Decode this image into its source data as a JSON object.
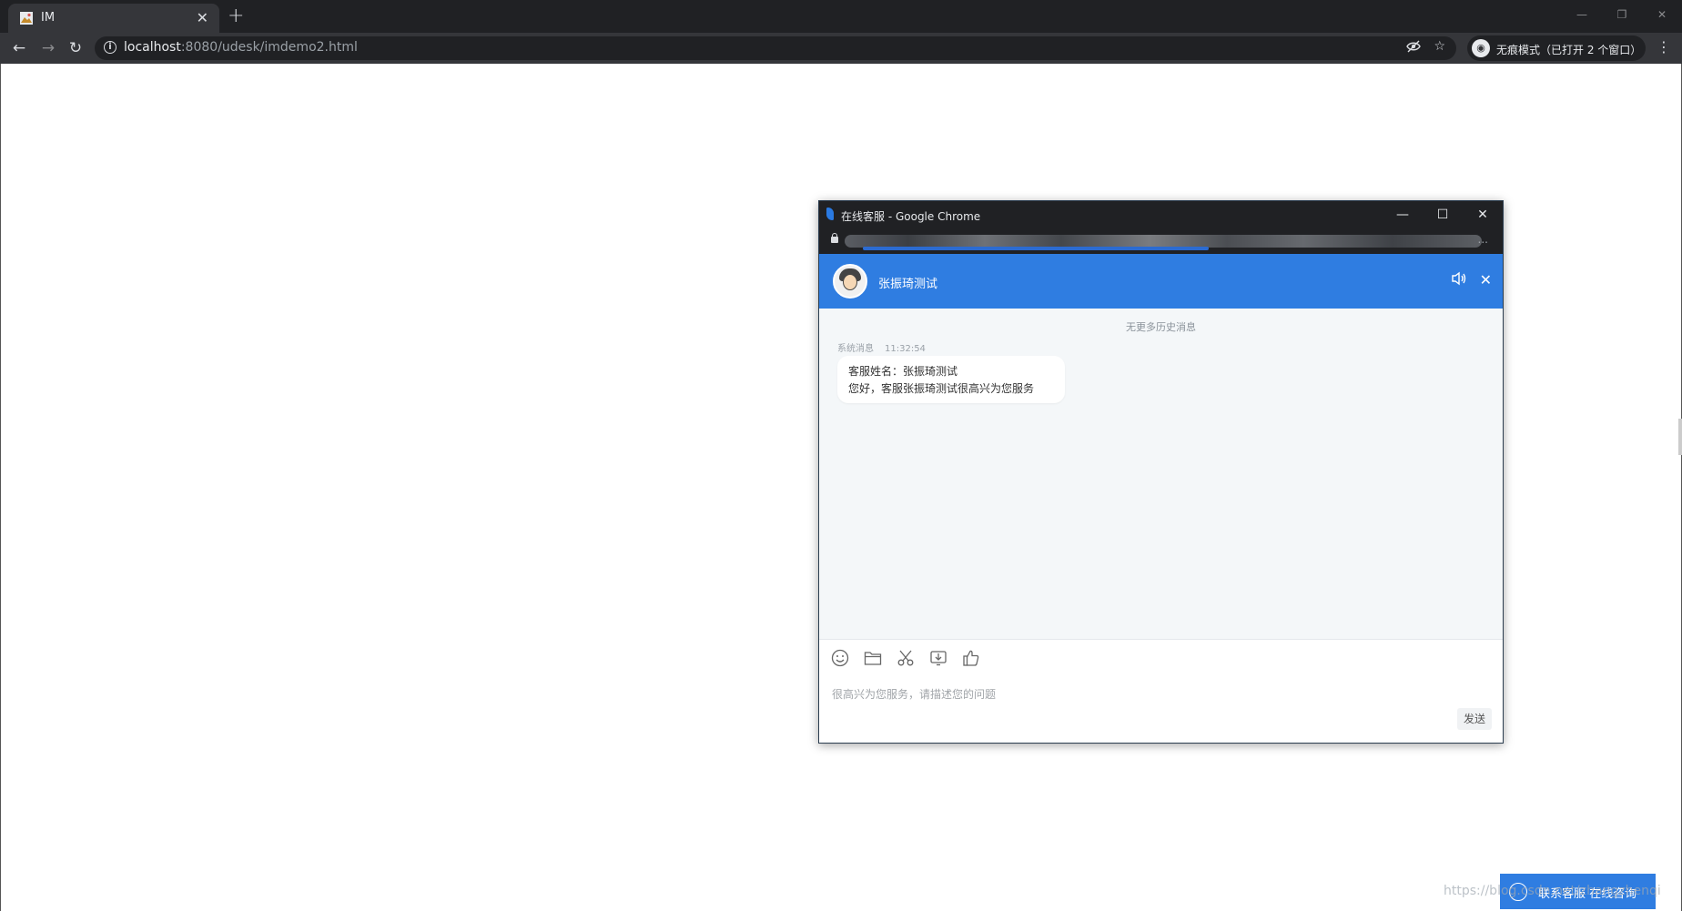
{
  "browser": {
    "tab_title": "IM",
    "url_host": "localhost",
    "url_rest": ":8080/udesk/imdemo2.html",
    "incognito_label": "无痕模式（已打开 2 个窗口）"
  },
  "popup": {
    "window_title": "在线客服 - Google Chrome",
    "url_ellipsis": "...",
    "agent_name": "张振琦测试"
  },
  "chat": {
    "no_history": "无更多历史消息",
    "sender": "系统消息",
    "time": "11:32:54",
    "line1": "客服姓名：张振琦测试",
    "line2": "您好，客服张振琦测试很高兴为您服务"
  },
  "composer": {
    "placeholder": "很高兴为您服务，请描述您的问题",
    "send_label": "发送",
    "tools": [
      "emoji-icon",
      "folder-icon",
      "scissors-icon",
      "download-icon",
      "thumbs-up-icon"
    ]
  },
  "launcher": {
    "label": "联系客服 在线咨询"
  },
  "watermark": "https://blog.csdn.net/zhangzhenqi",
  "colors": {
    "accent": "#2f7de1",
    "chrome_dark": "#202124",
    "chrome_toolbar": "#35363a"
  }
}
